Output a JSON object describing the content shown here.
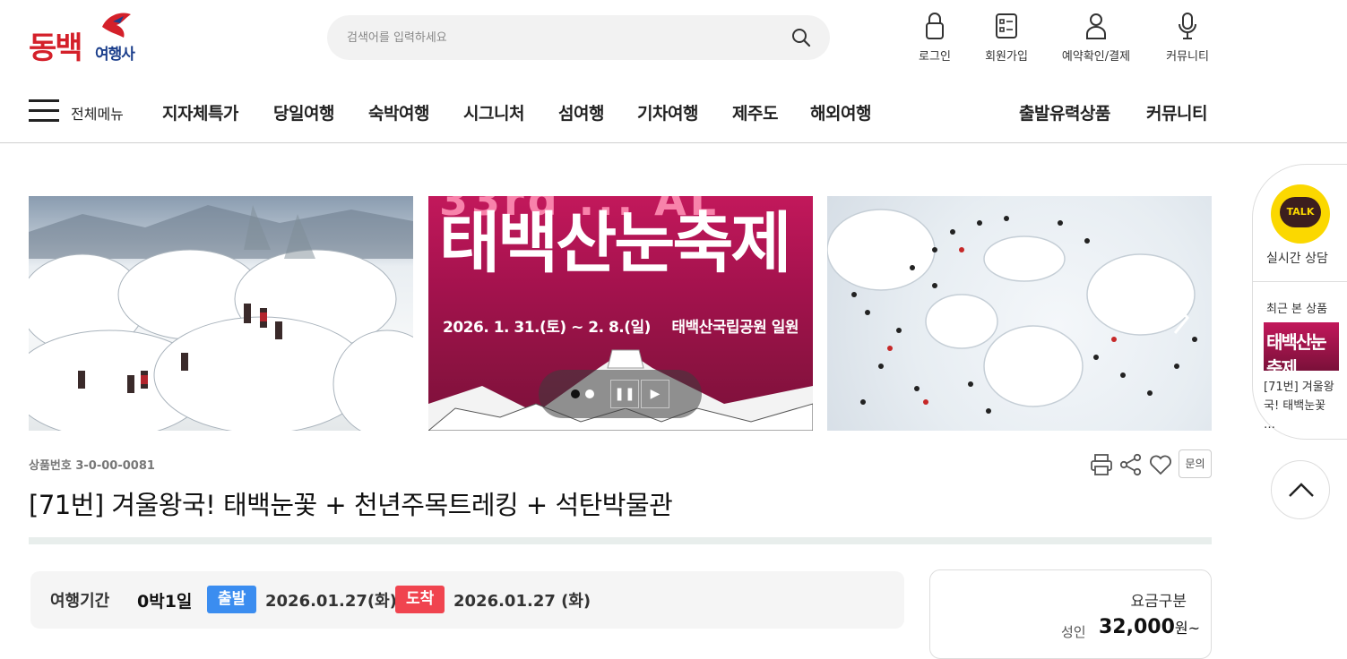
{
  "brand": {
    "name": "동백",
    "sub": "여행사"
  },
  "search": {
    "placeholder": "검색어를 입력하세요"
  },
  "utility": [
    {
      "label": "로그인",
      "icon": "lock-icon"
    },
    {
      "label": "회원가입",
      "icon": "member-form-icon"
    },
    {
      "label": "예약확인/결제",
      "icon": "user-icon"
    },
    {
      "label": "커뮤니티",
      "icon": "microphone-icon"
    }
  ],
  "nav": {
    "all_menu": "전체메뉴",
    "items": [
      "지자체특가",
      "당일여행",
      "숙박여행",
      "시그니처",
      "섬여행",
      "기차여행",
      "제주도",
      "해외여행"
    ],
    "right": [
      "출발유력상품",
      "커뮤니티"
    ]
  },
  "banner": {
    "festival_title": "태백산눈축제",
    "festival_date": "2026. 1. 31.(토) ~ 2. 8.(일)",
    "festival_place": "태백산국립공원 일원",
    "controls": {
      "pause": "❚❚",
      "play": "▶"
    }
  },
  "product": {
    "number": "상품번호 3-0-00-0081",
    "title": "[71번] 겨울왕국! 태백눈꽃 + 천년주목트레킹 + 석탄박물관",
    "inquiry": "문의",
    "period_label": "여행기간",
    "nights": "0박1일",
    "depart_tag": "출발",
    "depart_date": "2026.01.27(화)",
    "arrive_tag": "도착",
    "arrive_date": "2026.01.27 (화)"
  },
  "price": {
    "label": "요금구분",
    "adult_label": "성인",
    "adult_price": "32,000",
    "unit": "원~"
  },
  "side": {
    "talk": "TALK",
    "talk_label": "실시간 상담",
    "recent_label": "최근 본 상품",
    "recent_thumb": "태백산눈축제",
    "recent_name": "[71번] 겨울왕국! 태백눈꽃 …"
  },
  "colors": {
    "brand_red": "#d4202a",
    "brand_blue": "#1c3f8c",
    "depart": "#3b8df0",
    "arrive": "#f0444f",
    "kakao": "#fbd800"
  }
}
